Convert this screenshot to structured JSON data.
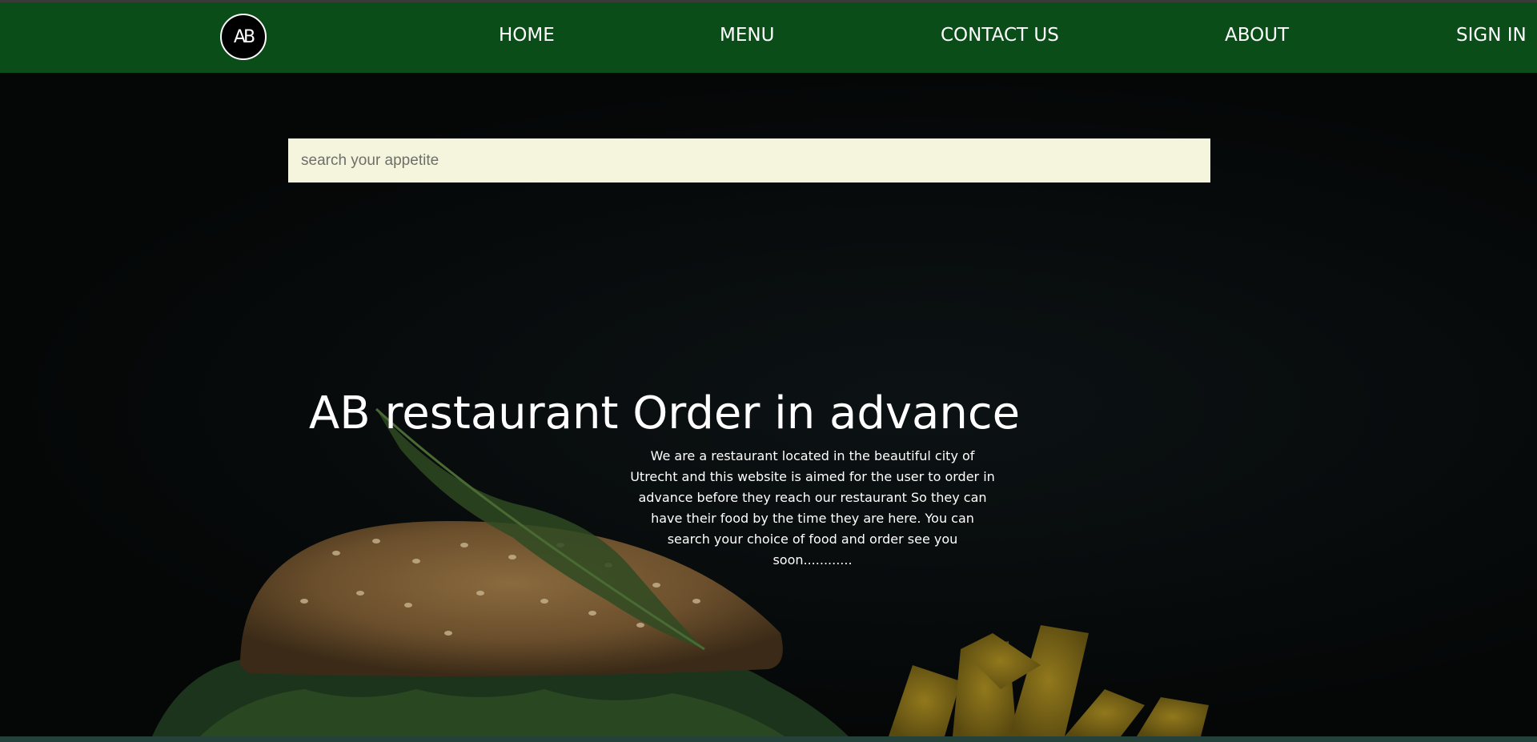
{
  "nav": {
    "logo_text": "AB",
    "items": [
      {
        "label": "HOME"
      },
      {
        "label": "MENU"
      },
      {
        "label": "CONTACT US"
      },
      {
        "label": "ABOUT"
      },
      {
        "label": "SIGN IN"
      }
    ]
  },
  "search": {
    "placeholder": "search your appetite",
    "value": ""
  },
  "hero": {
    "title": "AB restaurant Order in advance",
    "description": "We are a restaurant located in the beautiful city of Utrecht and this website is aimed for the user to order in advance before they reach our restaurant So they can have their food by the time they are here. You can search your choice of food and order see you soon............"
  },
  "colors": {
    "navbar": "#0b4d18",
    "search_background": "#f5f4dc",
    "page_background": "#050707",
    "text": "#ffffff"
  }
}
